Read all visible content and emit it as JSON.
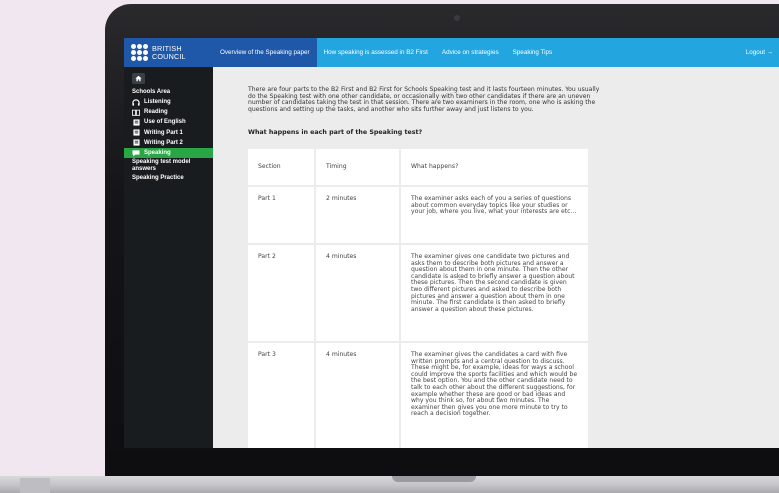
{
  "header": {
    "logo_text": "BRITISH\nCOUNCIL",
    "tabs": [
      {
        "label": "Overview of the Speaking paper",
        "active": true
      },
      {
        "label": "How speaking is assessed in B2 First",
        "active": false
      },
      {
        "label": "Advice on strategies",
        "active": false
      },
      {
        "label": "Speaking Tips",
        "active": false
      }
    ],
    "logout": "Logout →"
  },
  "sidebar": {
    "home_icon": "home-icon",
    "heading": "Schools Area",
    "items": [
      {
        "label": "Listening",
        "icon": "headphones-icon",
        "active": false
      },
      {
        "label": "Reading",
        "icon": "book-icon",
        "active": false
      },
      {
        "label": "Use of English",
        "icon": "document-icon",
        "active": false
      },
      {
        "label": "Writing Part 1",
        "icon": "document-icon",
        "active": false
      },
      {
        "label": "Writing Part 2",
        "icon": "document-icon",
        "active": false
      },
      {
        "label": "Speaking",
        "icon": "speech-bubble-icon",
        "active": true
      }
    ],
    "plain_items": [
      "Speaking test model answers",
      "Speaking Practice"
    ]
  },
  "content": {
    "intro": "There are four parts to the B2 First and B2 First for Schools Speaking test and it lasts fourteen minutes. You usually do the Speaking test with one other candidate, or occasionally with two other candidates if there are an uneven number of candidates taking the test in that session. There are two examiners in the room, one who is asking the questions and setting up the tasks, and another who sits further away and just listens to you.",
    "question": "What happens in each part of the Speaking test?",
    "table": {
      "headers": [
        "Section",
        "Timing",
        "What happens?"
      ],
      "rows": [
        [
          "Part 1",
          "2 minutes",
          "The examiner asks each of you a series of questions about common everyday topics like your studies or your job, where you live, what your interests are etc..."
        ],
        [
          "Part 2",
          "4 minutes",
          "The examiner gives one candidate two pictures and asks them to describe both pictures and answer a question about them in one minute. Then the other candidate is asked to briefly answer a question about these pictures. Then the second candidate is given two different pictures and asked to describe both pictures and answer a question about them in one minute. The first candidate is then asked to briefly answer a question about these pictures."
        ],
        [
          "Part 3",
          "4 minutes",
          "The examiner gives the candidates a card with five written prompts and a central question to discuss. These might be, for example, ideas for ways a school could improve the sports facilities and which would be the best option. You and the other candidate need to talk to each other about the different suggestions, for example whether these are good or bad ideas and why you think so, for about two minutes. The examiner then gives you one more minute to try to reach a decision together."
        ]
      ]
    }
  },
  "colors": {
    "topbar": "#23a6e0",
    "active_tab": "#1f58a8",
    "sidebar": "#191c1f",
    "active_sidebar": "#2aa745",
    "content_bg": "#ececec"
  }
}
